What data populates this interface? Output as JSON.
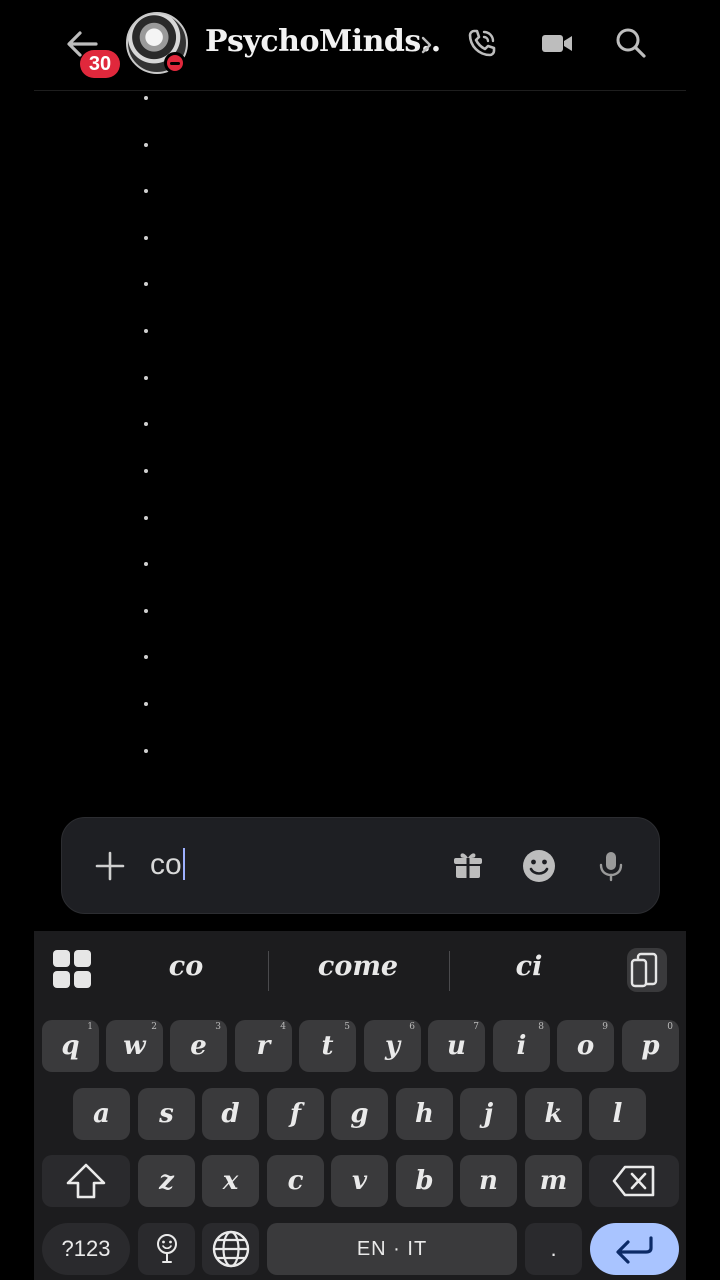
{
  "header": {
    "unread_count": "30",
    "title": "PsychoMinds..",
    "icons": [
      "back-arrow-icon",
      "chevron-right-icon",
      "voice-call-icon",
      "video-call-icon",
      "search-icon"
    ]
  },
  "composer": {
    "typed_text": "co",
    "icons": [
      "plus-icon",
      "gift-icon",
      "emoji-icon",
      "microphone-icon"
    ]
  },
  "keyboard": {
    "suggestions": [
      "co",
      "come",
      "ci"
    ],
    "row1": [
      {
        "label": "q",
        "hint": "1"
      },
      {
        "label": "w",
        "hint": "2"
      },
      {
        "label": "e",
        "hint": "3"
      },
      {
        "label": "r",
        "hint": "4"
      },
      {
        "label": "t",
        "hint": "5"
      },
      {
        "label": "y",
        "hint": "6"
      },
      {
        "label": "u",
        "hint": "7"
      },
      {
        "label": "i",
        "hint": "8"
      },
      {
        "label": "o",
        "hint": "9"
      },
      {
        "label": "p",
        "hint": "0"
      }
    ],
    "row2": [
      "a",
      "s",
      "d",
      "f",
      "g",
      "h",
      "j",
      "k",
      "l"
    ],
    "row3": [
      "z",
      "x",
      "c",
      "v",
      "b",
      "n",
      "m"
    ],
    "symbols_label": "?123",
    "space_label": "EN · IT",
    "period_label": ".",
    "accent": "#a9c4ff"
  },
  "colors": {
    "background": "#000000",
    "badge": "#e0283c",
    "composer": "#1e1f23",
    "keyboard": "#1c1c1e",
    "key": "#3a3a3c"
  }
}
